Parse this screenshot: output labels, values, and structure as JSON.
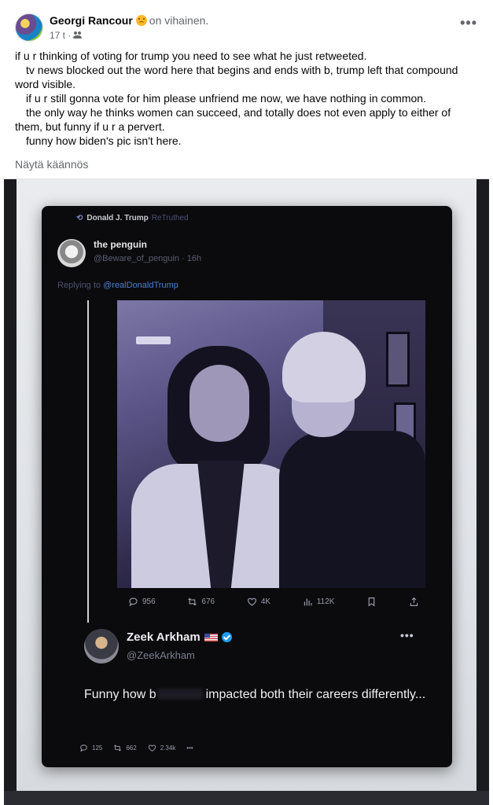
{
  "post": {
    "author": "Georgi Rancour",
    "feeling": "on vihainen.",
    "time": "17 t ·",
    "more": "•••",
    "paragraphs": [
      "if u r thinking of voting for trump you need to see what he just retweeted.",
      "tv news blocked out the word here that begins and ends with b, trump left that compound word visible.",
      "if u r still gonna vote for him please unfriend me now, we have nothing in common.",
      "the only way he thinks women can succeed, and totally does not even apply to either of them, but funny if u r a pervert.",
      "funny how biden's pic isn't here."
    ],
    "translate": "Näytä käännös"
  },
  "phone": {
    "retruth_by": "Donald J. Trump",
    "retruth_suffix": "ReTruthed",
    "original_name": "the penguin",
    "original_handle": "@Beware_of_penguin · 16h",
    "replying_prefix": "Replying to",
    "replying_to": "@realDonaldTrump",
    "stats": {
      "replies": "956",
      "retweets": "676",
      "likes": "4K",
      "views": "112K"
    },
    "quoted": {
      "name": "Zeek Arkham",
      "handle": "@ZeekArkham",
      "more": "•••",
      "text_before": "Funny how b",
      "text_after": "impacted both their careers differently..."
    },
    "bottom_stats": {
      "replies": "125",
      "retruths": "662",
      "likes": "2.34k",
      "more": "•••"
    }
  },
  "colors": {
    "link": "#4b7fd4",
    "verified": "#1d9bf0",
    "secondary_text": "#65676b"
  },
  "icons": [
    "friends-icon",
    "more-icon",
    "retruth-icon",
    "reply-icon",
    "retweet-icon",
    "like-icon",
    "views-icon",
    "bookmark-icon",
    "share-icon",
    "verified-icon",
    "flag-icon"
  ]
}
